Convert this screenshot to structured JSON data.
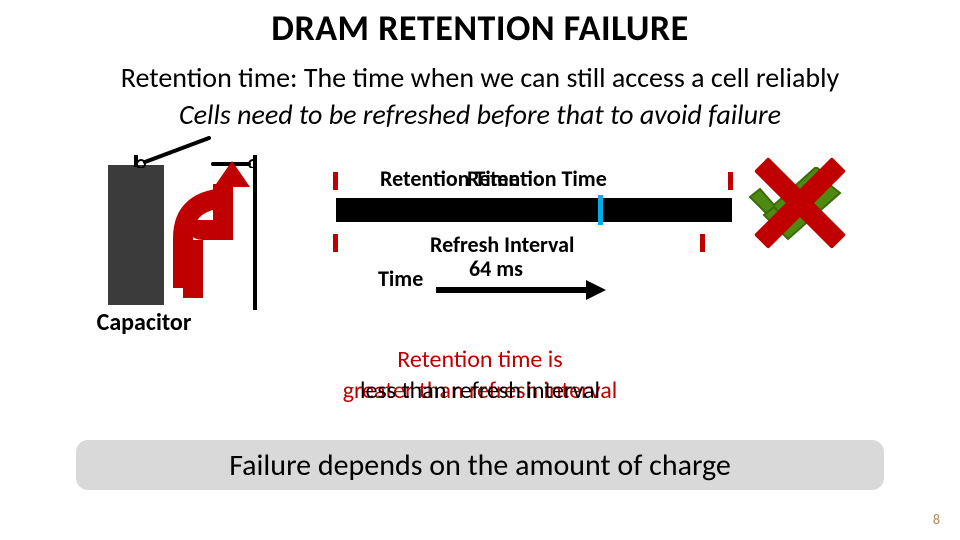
{
  "title": "DRAM RETENTION FAILURE",
  "line1": "Retention time: The time when we can still access a cell reliably",
  "line2": "Cells need to be refreshed before that to avoid failure",
  "capacitor_label": "Capacitor",
  "retention_label_1": "Retention Time",
  "retention_label_2": "Retention Time",
  "refresh_label": "Refresh Interval",
  "refresh_value": "64 ms",
  "time_label": "Time",
  "retention_statement_top": "Retention time is",
  "retention_statement_under": "greater than refresh interval",
  "retention_statement_over": "less than refresh interval",
  "bottom_bar": "Failure depends on the amount of charge",
  "page_number": "8",
  "colors": {
    "accent_red": "#c00000",
    "accent_green": "#4f8a10",
    "accent_cyan": "#00aee6",
    "bar_gray": "#d9d9d9"
  },
  "chart_data": {
    "type": "diagram",
    "annotations": [
      "Capacitor with open switch leaking charge (red arrow up)",
      "Retention Time span (red ticks above black bar)",
      "Black timeline bar with cyan marker",
      "Refresh Interval span (red ticks below), labeled 64 ms, Time arrow",
      "Two green checkmarks overlaid by large red X"
    ]
  }
}
